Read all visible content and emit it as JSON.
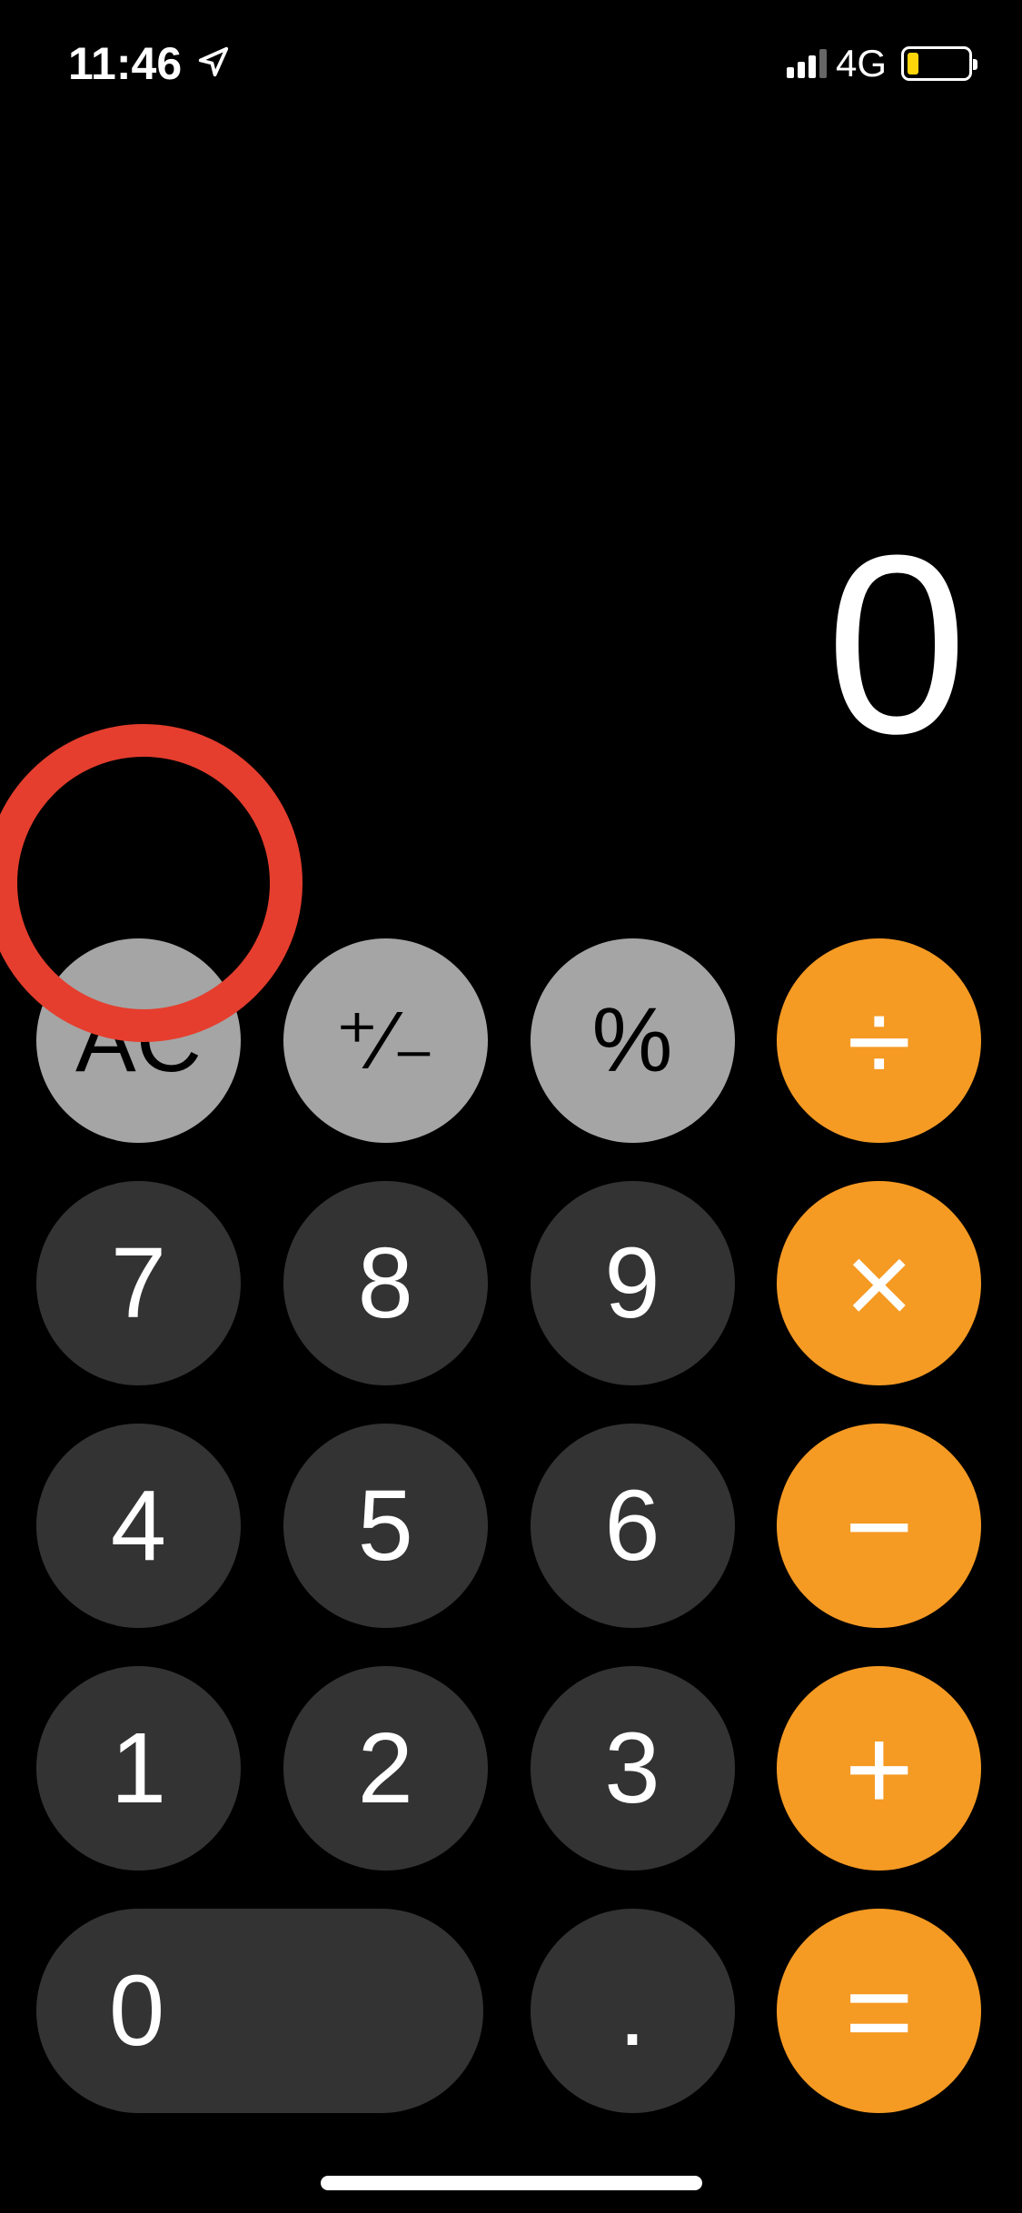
{
  "status_bar": {
    "time": "11:46",
    "network": "4G"
  },
  "display": {
    "value": "0"
  },
  "buttons": {
    "clear": "AC",
    "sign": "⁺⁄₋",
    "percent": "%",
    "divide": "÷",
    "seven": "7",
    "eight": "8",
    "nine": "9",
    "multiply": "×",
    "four": "4",
    "five": "5",
    "six": "6",
    "minus": "−",
    "one": "1",
    "two": "2",
    "three": "3",
    "plus": "+",
    "zero": "0",
    "decimal": ".",
    "equals": "="
  }
}
